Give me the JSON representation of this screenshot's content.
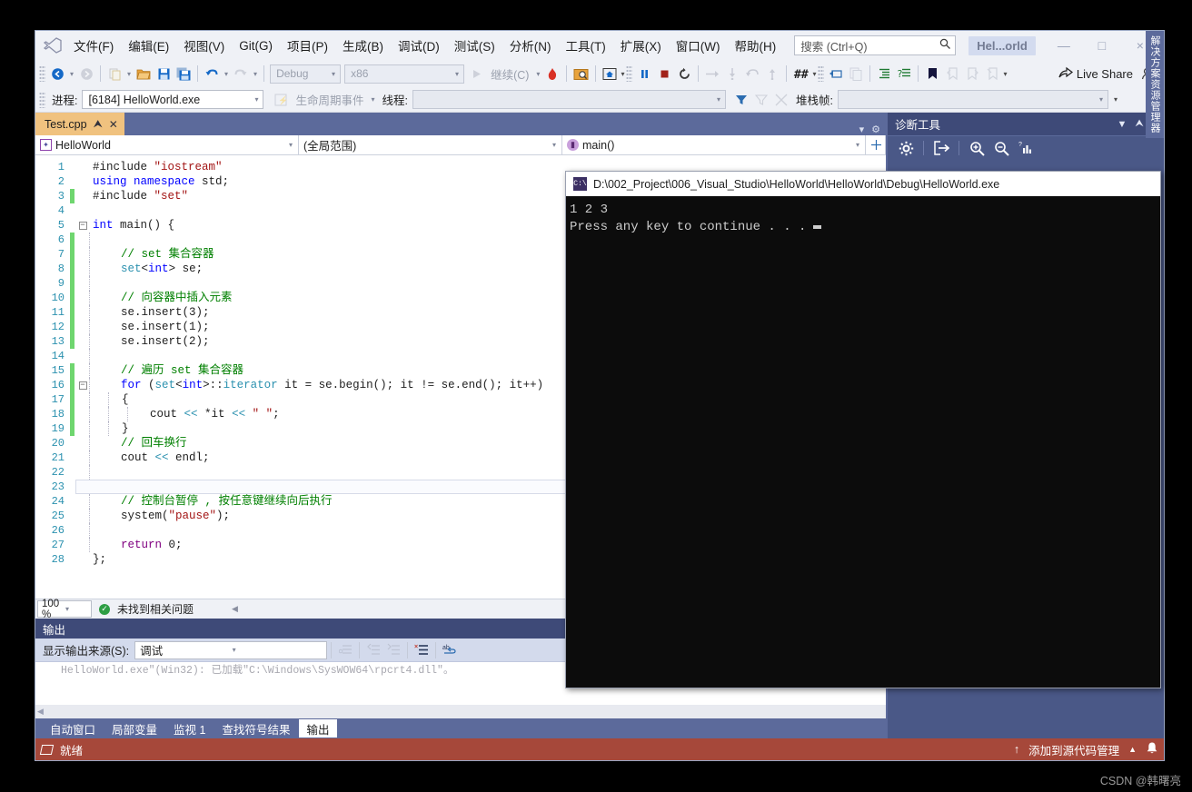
{
  "window": {
    "project_chip": "Hel...orld",
    "minimize": "—",
    "maximize": "□",
    "close": "×"
  },
  "menu": {
    "items": [
      "文件(F)",
      "编辑(E)",
      "视图(V)",
      "Git(G)",
      "项目(P)",
      "生成(B)",
      "调试(D)",
      "测试(S)",
      "分析(N)",
      "工具(T)",
      "扩展(X)",
      "窗口(W)",
      "帮助(H)"
    ]
  },
  "search": {
    "placeholder": "搜索 (Ctrl+Q)",
    "icon": "search-icon"
  },
  "toolbar": {
    "back_icon": "←",
    "forward_icon": "→",
    "new_item_icon": "⧉",
    "open_icon": "📂",
    "save_icon": "💾",
    "save_all_icon": "💾",
    "undo_icon": "↶",
    "redo_icon": "↷",
    "config_combo": "Debug",
    "platform_combo": "x86",
    "continue_label": "继续(C)",
    "hot_reload_icon": "🔥",
    "attach_icon": "🔍",
    "home_icon": "⌂",
    "pause_icon": "❘❘",
    "stop_icon": "■",
    "restart_icon": "↺",
    "step_over_icon": "→",
    "step_into_icon": "↓",
    "step_out_icon": "↑",
    "hex_icon": "#",
    "thread_icon": "⎘",
    "copy_icon": "❐",
    "indent_icon": "≣",
    "comment_icon": "≡",
    "bookmark_icon": "⚑",
    "live_share": "Live Share",
    "live_share_icon": "share-icon",
    "feedback_icon": "⚘"
  },
  "debugbar": {
    "process_label": "进程:",
    "process_value": "[6184] HelloWorld.exe",
    "lifecycle_label": "生命周期事件",
    "thread_label": "线程:",
    "thread_value": "",
    "filter_icon": "▼",
    "stack_label": "堆栈帧:"
  },
  "doctab": {
    "name": "Test.cpp",
    "pin_icon": "⮝",
    "close_icon": "✕"
  },
  "navbar": {
    "project": "HelloWorld",
    "scope": "(全局范围)",
    "member": "main()"
  },
  "code": {
    "lines": [
      {
        "n": 1,
        "changed": false,
        "fold": "",
        "indent": 0,
        "tokens": [
          {
            "t": "#include ",
            "c": "plain"
          },
          {
            "t": "\"iostream\"",
            "c": "str"
          }
        ]
      },
      {
        "n": 2,
        "changed": false,
        "fold": "",
        "indent": 0,
        "tokens": [
          {
            "t": "using",
            "c": "blue"
          },
          {
            "t": " ",
            "c": "plain"
          },
          {
            "t": "namespace",
            "c": "blue"
          },
          {
            "t": " std;",
            "c": "plain"
          }
        ]
      },
      {
        "n": 3,
        "changed": true,
        "fold": "",
        "indent": 0,
        "tokens": [
          {
            "t": "#include ",
            "c": "plain"
          },
          {
            "t": "\"set\"",
            "c": "str"
          }
        ]
      },
      {
        "n": 4,
        "changed": false,
        "fold": "",
        "indent": 0,
        "tokens": []
      },
      {
        "n": 5,
        "changed": false,
        "fold": "-",
        "indent": 0,
        "tokens": [
          {
            "t": "int",
            "c": "blue"
          },
          {
            "t": " ",
            "c": "plain"
          },
          {
            "t": "main",
            "c": "plain"
          },
          {
            "t": "() {",
            "c": "plain"
          }
        ]
      },
      {
        "n": 6,
        "changed": true,
        "fold": "",
        "indent": 1,
        "tokens": []
      },
      {
        "n": 7,
        "changed": true,
        "fold": "",
        "indent": 1,
        "tokens": [
          {
            "t": "    // set 集合容器",
            "c": "cmt"
          }
        ]
      },
      {
        "n": 8,
        "changed": true,
        "fold": "",
        "indent": 1,
        "tokens": [
          {
            "t": "    ",
            "c": "plain"
          },
          {
            "t": "set",
            "c": "type"
          },
          {
            "t": "<",
            "c": "plain"
          },
          {
            "t": "int",
            "c": "blue"
          },
          {
            "t": "> se;",
            "c": "plain"
          }
        ]
      },
      {
        "n": 9,
        "changed": true,
        "fold": "",
        "indent": 1,
        "tokens": []
      },
      {
        "n": 10,
        "changed": true,
        "fold": "",
        "indent": 1,
        "tokens": [
          {
            "t": "    // 向容器中插入元素",
            "c": "cmt"
          }
        ]
      },
      {
        "n": 11,
        "changed": true,
        "fold": "",
        "indent": 1,
        "tokens": [
          {
            "t": "    se.insert(3);",
            "c": "plain"
          }
        ]
      },
      {
        "n": 12,
        "changed": true,
        "fold": "",
        "indent": 1,
        "tokens": [
          {
            "t": "    se.insert(1);",
            "c": "plain"
          }
        ]
      },
      {
        "n": 13,
        "changed": true,
        "fold": "",
        "indent": 1,
        "tokens": [
          {
            "t": "    se.insert(2);",
            "c": "plain"
          }
        ]
      },
      {
        "n": 14,
        "changed": false,
        "fold": "",
        "indent": 1,
        "tokens": []
      },
      {
        "n": 15,
        "changed": true,
        "fold": "",
        "indent": 1,
        "tokens": [
          {
            "t": "    // 遍历 set 集合容器",
            "c": "cmt"
          }
        ]
      },
      {
        "n": 16,
        "changed": true,
        "fold": "-",
        "indent": 1,
        "tokens": [
          {
            "t": "    ",
            "c": "plain"
          },
          {
            "t": "for",
            "c": "blue"
          },
          {
            "t": " (",
            "c": "plain"
          },
          {
            "t": "set",
            "c": "type"
          },
          {
            "t": "<",
            "c": "plain"
          },
          {
            "t": "int",
            "c": "blue"
          },
          {
            "t": ">::",
            "c": "plain"
          },
          {
            "t": "iterator",
            "c": "type"
          },
          {
            "t": " it = se.begin(); it != se.end(); it++)",
            "c": "plain"
          }
        ]
      },
      {
        "n": 17,
        "changed": true,
        "fold": "",
        "indent": 2,
        "tokens": [
          {
            "t": "    {",
            "c": "plain"
          }
        ]
      },
      {
        "n": 18,
        "changed": true,
        "fold": "",
        "indent": 3,
        "tokens": [
          {
            "t": "        cout ",
            "c": "plain"
          },
          {
            "t": "<<",
            "c": "teal"
          },
          {
            "t": " *it ",
            "c": "plain"
          },
          {
            "t": "<<",
            "c": "teal"
          },
          {
            "t": " ",
            "c": "plain"
          },
          {
            "t": "\" \"",
            "c": "str"
          },
          {
            "t": ";",
            "c": "plain"
          }
        ]
      },
      {
        "n": 19,
        "changed": true,
        "fold": "",
        "indent": 2,
        "tokens": [
          {
            "t": "    }",
            "c": "plain"
          }
        ]
      },
      {
        "n": 20,
        "changed": false,
        "fold": "",
        "indent": 1,
        "tokens": [
          {
            "t": "    // 回车换行",
            "c": "cmt"
          }
        ]
      },
      {
        "n": 21,
        "changed": false,
        "fold": "",
        "indent": 1,
        "tokens": [
          {
            "t": "    cout ",
            "c": "plain"
          },
          {
            "t": "<<",
            "c": "teal"
          },
          {
            "t": " endl;",
            "c": "plain"
          }
        ]
      },
      {
        "n": 22,
        "changed": false,
        "fold": "",
        "indent": 1,
        "tokens": []
      },
      {
        "n": 23,
        "changed": false,
        "fold": "",
        "indent": 1,
        "tokens": []
      },
      {
        "n": 24,
        "changed": false,
        "fold": "",
        "indent": 1,
        "tokens": [
          {
            "t": "    // 控制台暂停 , 按任意键继续向后执行",
            "c": "cmt"
          }
        ]
      },
      {
        "n": 25,
        "changed": false,
        "fold": "",
        "indent": 1,
        "tokens": [
          {
            "t": "    system(",
            "c": "plain"
          },
          {
            "t": "\"pause\"",
            "c": "str"
          },
          {
            "t": ");",
            "c": "plain"
          }
        ]
      },
      {
        "n": 26,
        "changed": false,
        "fold": "",
        "indent": 1,
        "tokens": []
      },
      {
        "n": 27,
        "changed": false,
        "fold": "",
        "indent": 1,
        "tokens": [
          {
            "t": "    ",
            "c": "plain"
          },
          {
            "t": "return",
            "c": "purple"
          },
          {
            "t": " 0;",
            "c": "plain"
          }
        ]
      },
      {
        "n": 28,
        "changed": false,
        "fold": "",
        "indent": 0,
        "tokens": [
          {
            "t": "};",
            "c": "plain"
          }
        ]
      }
    ],
    "current_line": 23
  },
  "editor_status": {
    "zoom": "100 %",
    "issues": "未找到相关问题",
    "ok_icon": "✓"
  },
  "output": {
    "title": "输出",
    "source_label": "显示输出来源(S):",
    "source_value": "调试",
    "text": "HelloWorld.exe\"(Win32): 已加载\"C:\\Windows\\SysWOW64\\rpcrt4.dll\"。",
    "toolbar_icons": [
      "find-message-icon",
      "jump-prev-icon",
      "jump-next-icon",
      "clear-all-icon",
      "word-wrap-icon"
    ]
  },
  "bottom_tabs": [
    {
      "label": "自动窗口",
      "active": false
    },
    {
      "label": "局部变量",
      "active": false
    },
    {
      "label": "监视 1",
      "active": false
    },
    {
      "label": "查找符号结果",
      "active": false
    },
    {
      "label": "输出",
      "active": true
    }
  ],
  "statusbar": {
    "ready": "就绪",
    "source_control": "添加到源代码管理",
    "up_icon": "↑",
    "chevron_icon": "▲",
    "bell_icon": "🔔"
  },
  "diagnostics": {
    "title": "诊断工具",
    "dropdown_icon": "▼",
    "pin_icon": "⮝",
    "close_icon": "✕",
    "settings_icon": "⚙",
    "export_icon": "↦",
    "zoom_in_icon": "⊕",
    "zoom_out_icon": "⊖",
    "chart_icon": "📊"
  },
  "solution_explorer_tab": "解决方案资源管理器",
  "console": {
    "icon_text": "C:\\",
    "title": "D:\\002_Project\\006_Visual_Studio\\HelloWorld\\HelloWorld\\Debug\\HelloWorld.exe",
    "output_line1": "1 2 3",
    "output_line2": "Press any key to continue . . ."
  },
  "watermark": "CSDN @韩曙亮",
  "colors": {
    "accent_blue": "#5c6a9b",
    "status_red": "#a6483a",
    "tab_orange": "#f0c27f",
    "panel_chrome": "#eff1f6",
    "comment_green": "#008000",
    "string_red": "#a31515",
    "keyword_blue": "#0000ff"
  }
}
